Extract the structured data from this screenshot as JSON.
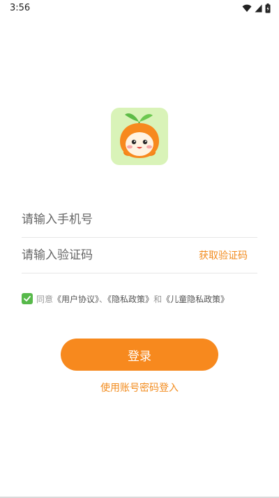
{
  "status_bar": {
    "time": "3:56",
    "icons": [
      "wifi-icon",
      "cell-signal-icon",
      "battery-icon"
    ]
  },
  "logo": {
    "icon": "orange-mascot-logo",
    "background_color": "#d9f3b8",
    "accent_color": "#f7891e"
  },
  "form": {
    "phone_placeholder": "请输入手机号",
    "code_placeholder": "请输入验证码",
    "get_code_label": "获取验证码"
  },
  "agreement": {
    "checked": true,
    "prefix": "同意",
    "user_agreement": "《用户协议》",
    "separator": "、",
    "privacy_policy": "《隐私政策》",
    "and": "和",
    "children_privacy_policy": "《儿童隐私政策》"
  },
  "actions": {
    "login_label": "登录",
    "password_login_label": "使用账号密码登入"
  },
  "colors": {
    "accent": "#f7891e",
    "checkbox": "#57b94a"
  }
}
